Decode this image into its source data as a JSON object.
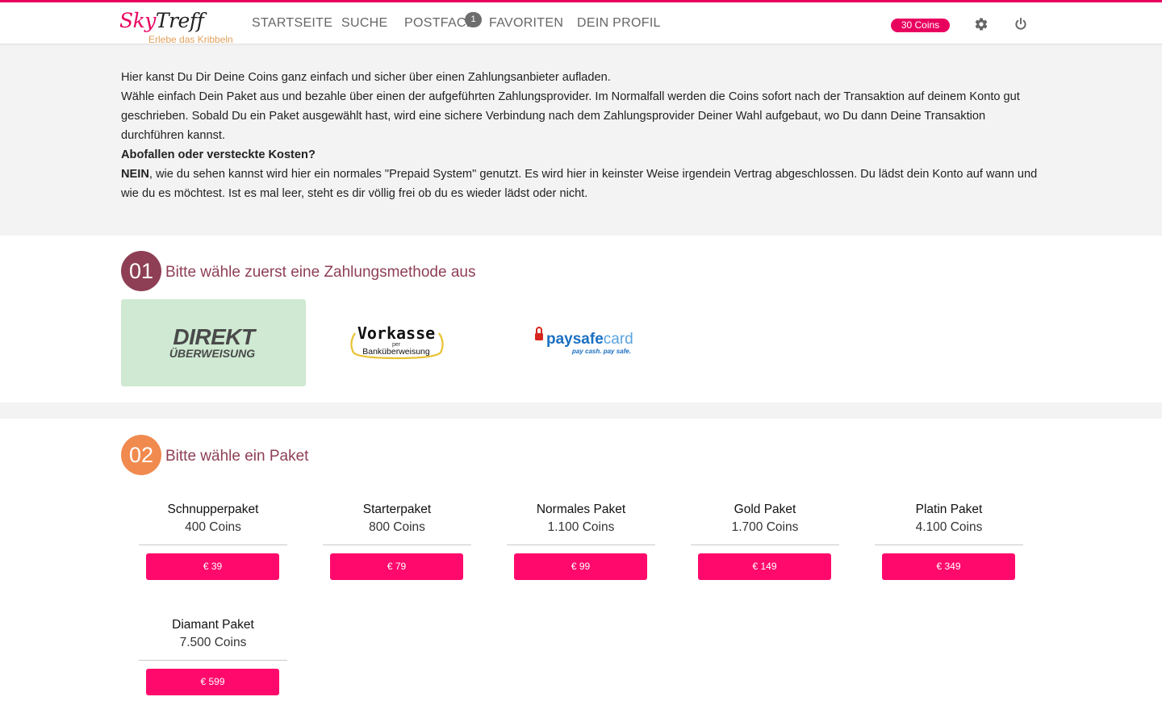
{
  "header": {
    "logo": {
      "part1": "Sky",
      "part2": "Treff",
      "tagline": "Erlebe das Kribbeln"
    },
    "nav": [
      "STARTSEITE",
      "SUCHE",
      "POSTFACH",
      "FAVORITEN",
      "DEIN PROFIL"
    ],
    "mail_badge": "1",
    "coins": "30 Coins",
    "icons": [
      "settings-gear-icon",
      "power-logout-icon"
    ],
    "accent": "#e8005f"
  },
  "intro": {
    "line1": "Hier kanst Du Dir Deine Coins ganz einfach und sicher über einen Zahlungsanbieter aufladen.",
    "line2": "Wähle einfach Dein Paket aus und bezahle über einen der aufgeführten Zahlungsprovider. Im Normalfall werden die Coins sofort nach der Transaktion auf deinem Konto gut geschrieben. Sobald Du ein Paket ausgewählt hast, wird eine sichere Verbindung nach dem Zahlungsprovider Deiner Wahl aufgebaut, wo Du dann Deine Transaktion durchführen kannst.",
    "question": "Abofallen oder versteckte Kosten?",
    "answer_bold": "NEIN",
    "answer_rest": ", wie du sehen kannst wird hier ein normales \"Prepaid System\" genutzt. Es wird hier in keinster Weise irgendein Vertrag abgeschlossen. Du lädst dein Konto auf wann und wie du es möchtest. Ist es mal leer, steht es dir völlig frei ob du es wieder lädst oder nicht."
  },
  "step1": {
    "number": "01",
    "title": "Bitte wähle zuerst eine Zahlungsmethode aus",
    "circle_color": "#8e3f55",
    "methods": [
      {
        "name": "direkt-ueberweisung",
        "line1": "DIREKT",
        "line2": "ÜBERWEISUNG",
        "selected": true
      },
      {
        "name": "vorkasse",
        "line1": "Vorkasse",
        "line2": "per",
        "line3": "Banküberweisung",
        "selected": false
      },
      {
        "name": "paysafecard",
        "line1": "paysafe",
        "line1b": "card",
        "line2": "pay cash. pay safe.",
        "selected": false
      }
    ]
  },
  "step2": {
    "number": "02",
    "title": "Bitte wähle ein Paket",
    "circle_color": "#f08a4e",
    "packages": [
      {
        "name": "Schnupperpaket",
        "coins": "400 Coins",
        "price": "€ 39"
      },
      {
        "name": "Starterpaket",
        "coins": "800 Coins",
        "price": "€ 79"
      },
      {
        "name": "Normales Paket",
        "coins": "1.100 Coins",
        "price": "€ 99"
      },
      {
        "name": "Gold Paket",
        "coins": "1.700 Coins",
        "price": "€ 149"
      },
      {
        "name": "Platin Paket",
        "coins": "4.100 Coins",
        "price": "€ 349"
      },
      {
        "name": "Diamant Paket",
        "coins": "7.500 Coins",
        "price": "€ 599"
      }
    ]
  }
}
